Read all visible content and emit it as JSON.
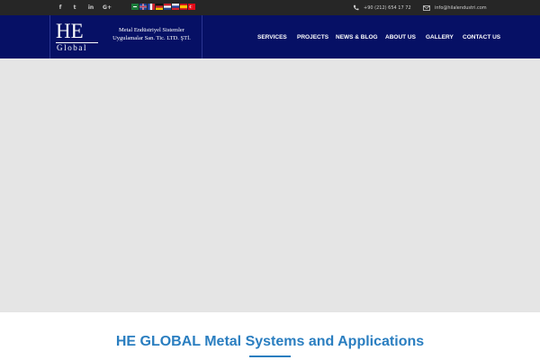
{
  "topbar": {
    "social_icons": [
      "facebook-icon",
      "twitter-icon",
      "linkedin-icon",
      "google-plus-icon"
    ],
    "social_labels": {
      "facebook": "f",
      "twitter": "t",
      "linkedin": "in",
      "google_plus": "G+"
    },
    "language_flags": [
      "saudi-arabia-flag-icon",
      "united-kingdom-flag-icon",
      "france-flag-icon",
      "germany-flag-icon",
      "netherlands-flag-icon",
      "russia-flag-icon",
      "spain-flag-icon",
      "turkey-flag-icon"
    ],
    "phone": "+90 (212) 654 17 72",
    "email": "info@hilalendustri.com"
  },
  "header": {
    "logo_he": "HE",
    "logo_global": "Global",
    "tagline_line1": "Metal Endüstriyel Sistemler",
    "tagline_line2": "Uygulamalar San. Tic. LTD. ŞTİ."
  },
  "nav": {
    "items": [
      "SERVICES",
      "PROJECTS",
      "NEWS & BLOG",
      "ABOUT US",
      "GALLERY",
      "CONTACT US"
    ]
  },
  "main": {
    "title": "HE GLOBAL Metal Systems and Applications"
  },
  "colors": {
    "header_bg": "#061065",
    "topbar_bg": "#262626",
    "hero_bg": "#e5e5e5",
    "title_accent": "#2a7ec0"
  }
}
